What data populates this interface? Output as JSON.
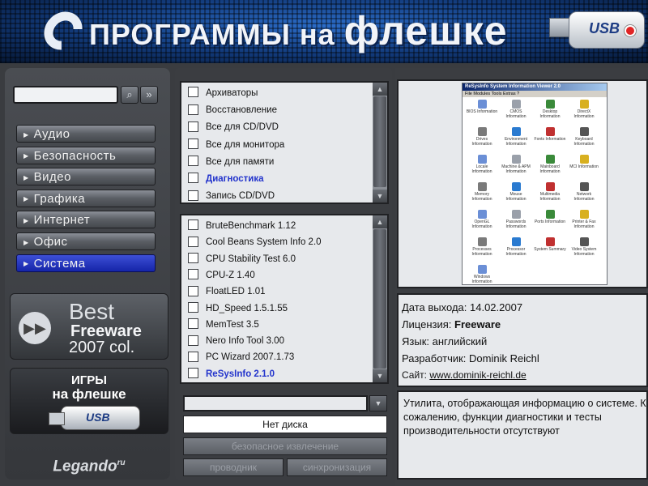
{
  "header": {
    "title_small": "ПРОГРАММЫ на",
    "title_big": "флешке",
    "usb_label": "USB"
  },
  "search": {
    "value": "",
    "search_icon": "magnifier-icon",
    "forward_icon": "double-arrow-icon"
  },
  "categories": [
    {
      "label": "Аудио",
      "active": false
    },
    {
      "label": "Безопасность",
      "active": false
    },
    {
      "label": "Видео",
      "active": false
    },
    {
      "label": "Графика",
      "active": false
    },
    {
      "label": "Интернет",
      "active": false
    },
    {
      "label": "Офис",
      "active": false
    },
    {
      "label": "Система",
      "active": true
    }
  ],
  "banner_best": {
    "line1": "Best",
    "line2": "Freeware",
    "line3": "2007 col."
  },
  "banner_games": {
    "line1": "ИГРЫ",
    "line2": "на флешке",
    "usb": "USB"
  },
  "footer_logo": {
    "text": "Legando",
    "suffix": "ru"
  },
  "subcategories": [
    "Архиваторы",
    "Восстановление",
    "Все для CD/DVD",
    "Все для монитора",
    "Все для памяти",
    "Диагностика",
    "Запись CD/DVD"
  ],
  "subcategory_selected": 5,
  "programs": [
    "BruteBenchmark 1.12",
    "Cool Beans System Info 2.0",
    "CPU Stability Test 6.0",
    "CPU-Z 1.40",
    "FloatLED 1.01",
    "HD_Speed 1.5.1.55",
    "MemTest 3.5",
    "Nero Info Tool 3.00",
    "PC Wizard 2007.1.73",
    "ReSysInfo 2.1.0"
  ],
  "program_selected": 9,
  "drive": {
    "value": "",
    "status": "Нет диска"
  },
  "buttons": {
    "eject": "безопасное извлечение",
    "explorer": "проводник",
    "sync": "синхронизация"
  },
  "screenshot": {
    "title": "ReSysInfo System Information Viewer 2.0",
    "menu": "File  Modules  Tools  Extras  ?",
    "icons": [
      "BIOS Information",
      "CMOS Information",
      "Desktop Information",
      "DirectX Information",
      "Drives Information",
      "Environment Information",
      "Fonts Information",
      "Keyboard Information",
      "Locale Information",
      "Machine & APM Information",
      "Mainboard Information",
      "MCI Information",
      "Memory Information",
      "Mouse Information",
      "Multimedia Information",
      "Network Information",
      "OpenGL Information",
      "Passwords Information",
      "Ports Information",
      "Printer & Fax Information",
      "Processes Information",
      "Processor Information",
      "System Summary",
      "Video System Information",
      "Windows Information"
    ]
  },
  "info": {
    "release_label": "Дата выхода:",
    "release": "14.02.2007",
    "license_label": "Лицензия:",
    "license": "Freeware",
    "lang_label": "Язык:",
    "lang": "английский",
    "dev_label": "Разработчик:",
    "dev": "Dominik Reichl",
    "site_label": "Сайт:",
    "site": "www.dominik-reichl.de"
  },
  "description": "Утилита, отображающая информацию о системе. К сожалению, функции диагностики и тесты производительности отсутствуют"
}
